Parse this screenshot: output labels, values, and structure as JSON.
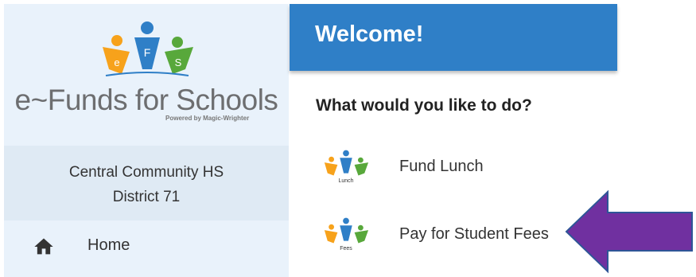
{
  "logo": {
    "title": "e~Funds for Schools",
    "subtitle": "Powered by Magic-Wrighter",
    "letters": [
      "e",
      "F",
      "S"
    ]
  },
  "district": {
    "line1": "Central Community HS",
    "line2": "District 71"
  },
  "nav": {
    "home_label": "Home",
    "home_icon": "home-icon"
  },
  "header": {
    "title": "Welcome!"
  },
  "main": {
    "question": "What would you like to do?",
    "actions": [
      {
        "label": "Fund Lunch",
        "thumb_caption": "Lunch"
      },
      {
        "label": "Pay for Student Fees",
        "thumb_caption": "Fees"
      }
    ]
  },
  "colors": {
    "header": "#2f7fc7",
    "sidebar": "#e9f2fb",
    "district_band": "#dfeaf4",
    "arrow_fill": "#7030a0",
    "arrow_stroke": "#2f5597"
  }
}
